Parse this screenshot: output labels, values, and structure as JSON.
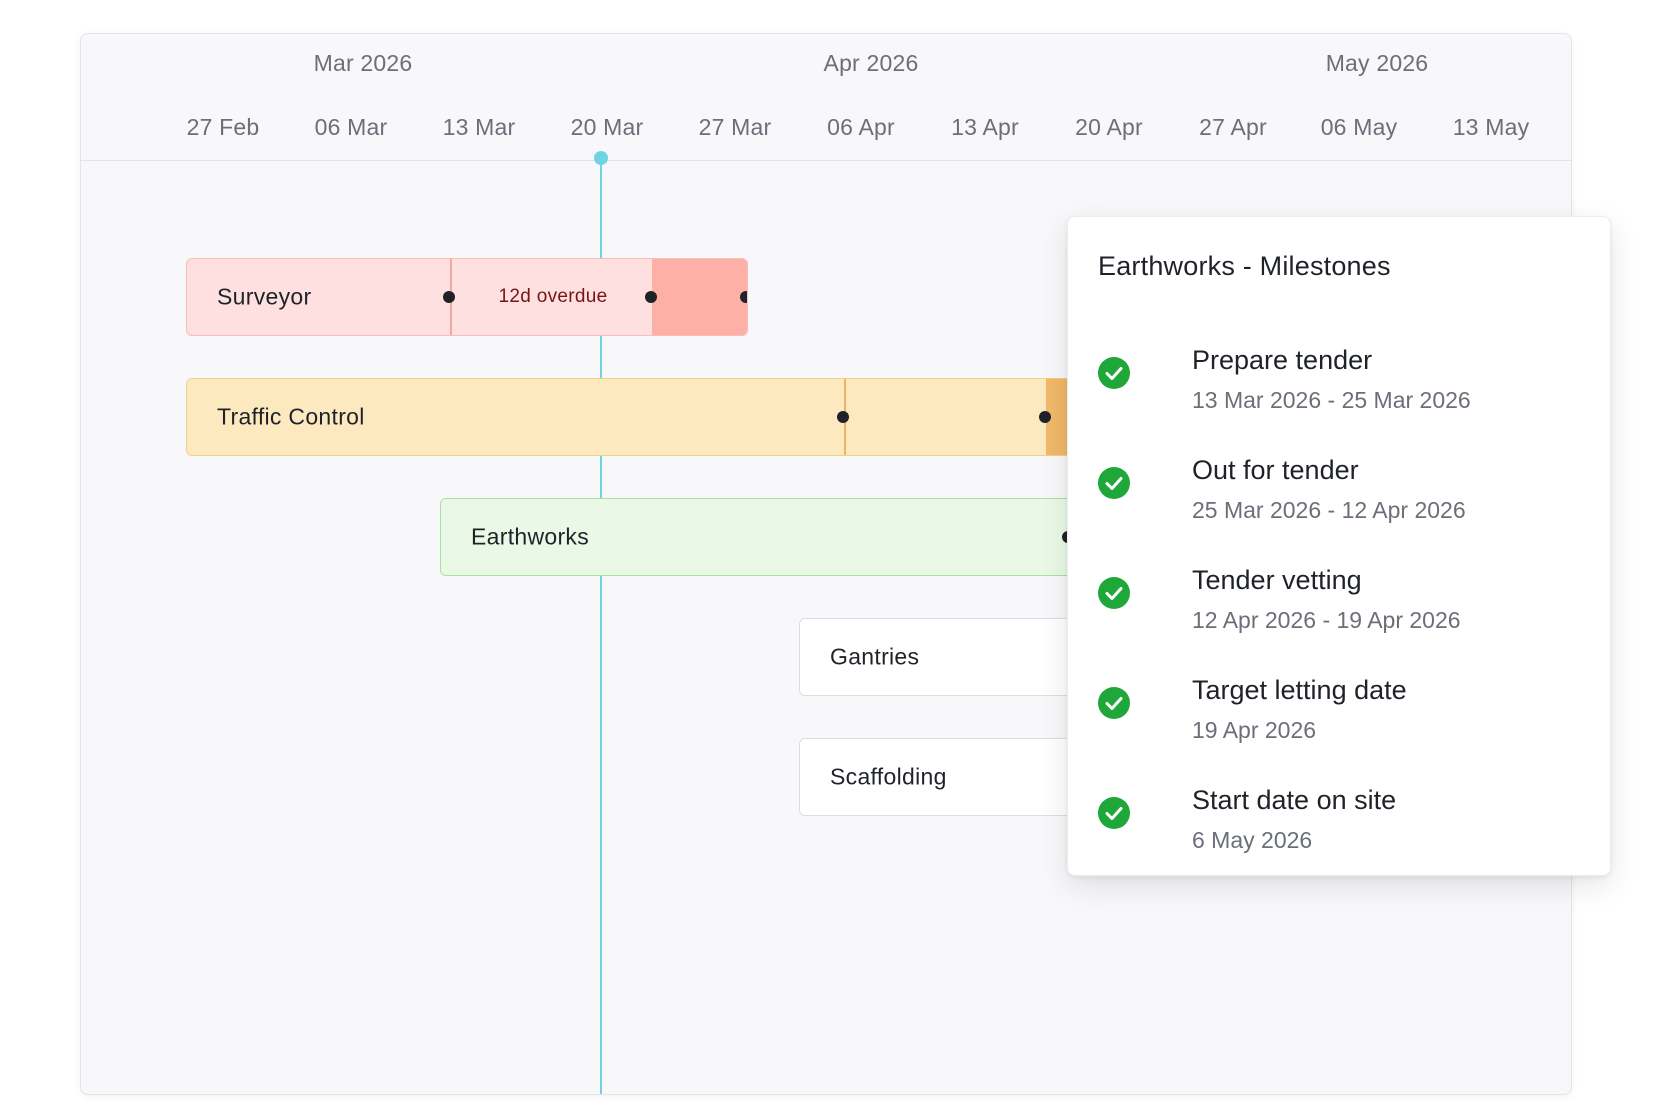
{
  "timeline": {
    "months": [
      "Mar 2026",
      "Apr 2026",
      "May 2026"
    ],
    "weeks": [
      "27 Feb",
      "06 Mar",
      "13 Mar",
      "20 Mar",
      "27 Mar",
      "06 Apr",
      "13 Apr",
      "20 Apr",
      "27 Apr",
      "06 May",
      "13 May"
    ]
  },
  "rows": [
    {
      "label": "Surveyor",
      "status": "overdue",
      "badge": "12d overdue"
    },
    {
      "label": "Traffic Control",
      "status": "in-progress"
    },
    {
      "label": "Earthworks",
      "status": "on-track"
    },
    {
      "label": "Gantries",
      "status": "not-started"
    },
    {
      "label": "Scaffolding",
      "status": "not-started"
    }
  ],
  "colors": {
    "today_line": "#6fd3e3",
    "overdue_fill": "#fde0df",
    "overdue_accent": "#fdb0a6",
    "warning_fill": "#fde9c0",
    "warning_accent": "#f1b968",
    "success_fill": "#e9f9e6",
    "success_border": "#a8e0a0",
    "check_green": "#1fa73a"
  },
  "popover": {
    "title": "Earthworks - Milestones",
    "milestones": [
      {
        "name": "Prepare tender",
        "dates": "13 Mar 2026 - 25 Mar 2026",
        "icon": "check-circle-icon"
      },
      {
        "name": "Out for tender",
        "dates": "25 Mar 2026 - 12 Apr 2026",
        "icon": "check-circle-icon"
      },
      {
        "name": "Tender vetting",
        "dates": "12 Apr 2026 - 19 Apr 2026",
        "icon": "check-circle-icon"
      },
      {
        "name": "Target letting date",
        "dates": "19 Apr 2026",
        "icon": "check-circle-icon"
      },
      {
        "name": "Start date on site",
        "dates": "6 May 2026",
        "icon": "check-circle-icon"
      }
    ]
  }
}
